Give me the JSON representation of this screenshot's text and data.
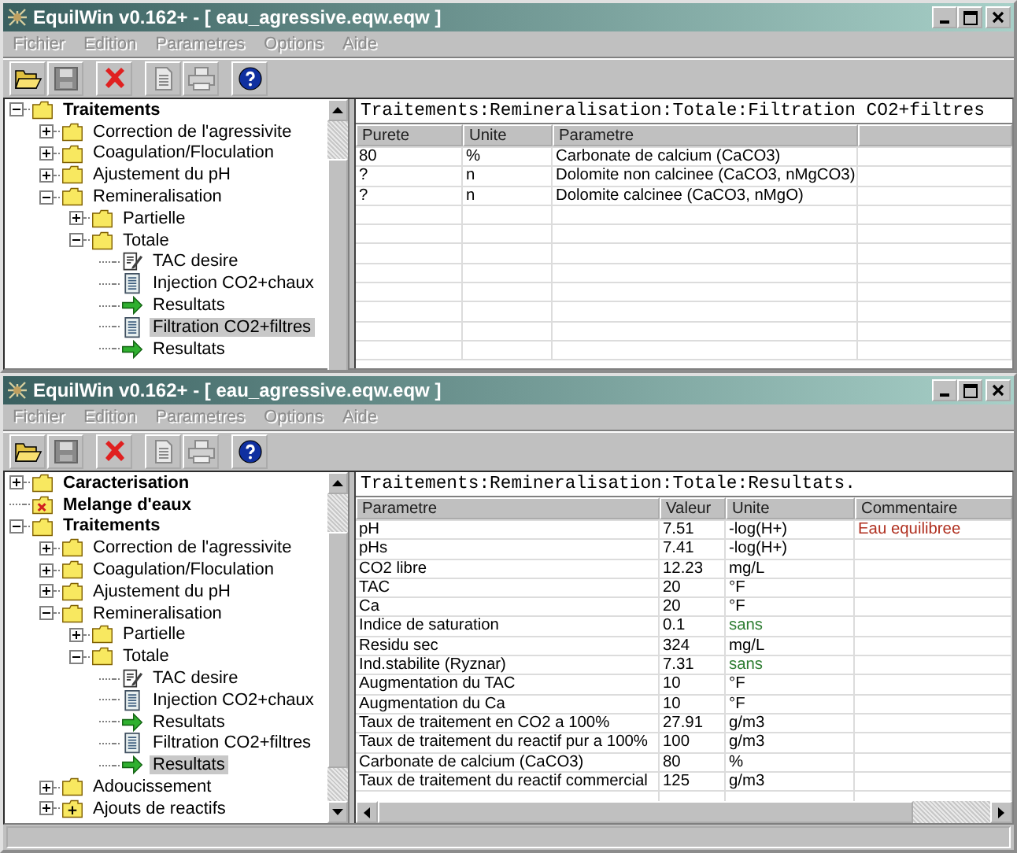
{
  "windows": [
    {
      "title": "EquilWin v0.162+ - [ eau_agressive.eqw.eqw ]",
      "menu": [
        {
          "label": "Fichier",
          "disabled": true
        },
        {
          "label": "Edition",
          "disabled": true
        },
        {
          "label": "Parametres",
          "disabled": true
        },
        {
          "label": "Options",
          "disabled": true
        },
        {
          "label": "Aide",
          "disabled": true
        }
      ],
      "toolbar_groups": [
        [
          {
            "kind": "open",
            "disabled": false
          },
          {
            "kind": "save",
            "disabled": true
          }
        ],
        [
          {
            "kind": "delete",
            "disabled": false
          }
        ],
        [
          {
            "kind": "copy",
            "disabled": true
          },
          {
            "kind": "print",
            "disabled": true
          }
        ],
        [
          {
            "kind": "help",
            "disabled": false
          }
        ]
      ],
      "tree": [
        {
          "label": "Traitements",
          "kind": "folder",
          "expanded": true,
          "selected": false,
          "children": [
            {
              "label": "Correction de l'agressivite",
              "kind": "folder",
              "expanded": false,
              "selected": false
            },
            {
              "label": "Coagulation/Floculation",
              "kind": "folder",
              "expanded": false,
              "selected": false
            },
            {
              "label": "Ajustement du pH",
              "kind": "folder",
              "expanded": false,
              "selected": false
            },
            {
              "label": "Remineralisation",
              "kind": "folder",
              "expanded": true,
              "selected": false,
              "children": [
                {
                  "label": "Partielle",
                  "kind": "folder",
                  "expanded": false,
                  "selected": false
                },
                {
                  "label": "Totale",
                  "kind": "folder",
                  "expanded": true,
                  "selected": false,
                  "children": [
                    {
                      "label": "TAC desire",
                      "kind": "form",
                      "selected": false
                    },
                    {
                      "label": "Injection CO2+chaux",
                      "kind": "doc",
                      "selected": false
                    },
                    {
                      "label": "Resultats",
                      "kind": "arrow",
                      "selected": false
                    },
                    {
                      "label": "Filtration CO2+filtres",
                      "kind": "doc",
                      "selected": true
                    },
                    {
                      "label": "Resultats",
                      "kind": "arrow",
                      "selected": false
                    }
                  ]
                }
              ]
            }
          ]
        }
      ],
      "heading": "Traitements:Remineralisation:Totale:Filtration CO2+filtres",
      "columns": [
        "Purete",
        "Unite",
        "Parametre",
        ""
      ],
      "rows": [
        [
          "80",
          "%",
          "Carbonate de calcium (CaCO3)"
        ],
        [
          "?",
          "n",
          "Dolomite non calcinee (CaCO3, nMgCO3)"
        ],
        [
          "?",
          "n",
          "Dolomite calcinee (CaCO3, nMgO)"
        ]
      ]
    },
    {
      "title": "EquilWin v0.162+ - [ eau_agressive.eqw.eqw ]",
      "menu": [
        {
          "label": "Fichier",
          "disabled": true
        },
        {
          "label": "Edition",
          "disabled": true
        },
        {
          "label": "Parametres",
          "disabled": true
        },
        {
          "label": "Options",
          "disabled": true
        },
        {
          "label": "Aide",
          "disabled": true
        }
      ],
      "toolbar_groups": [
        [
          {
            "kind": "open",
            "disabled": false
          },
          {
            "kind": "save",
            "disabled": true
          }
        ],
        [
          {
            "kind": "delete",
            "disabled": false
          }
        ],
        [
          {
            "kind": "copy",
            "disabled": true
          },
          {
            "kind": "print",
            "disabled": true
          }
        ],
        [
          {
            "kind": "help",
            "disabled": false
          }
        ]
      ],
      "tree": [
        {
          "label": "Caracterisation",
          "kind": "folder",
          "expanded": false,
          "selected": false
        },
        {
          "label": "Melange d'eaux",
          "kind": "folder-x",
          "selected": false
        },
        {
          "label": "Traitements",
          "kind": "folder",
          "expanded": true,
          "selected": false,
          "children": [
            {
              "label": "Correction de l'agressivite",
              "kind": "folder",
              "expanded": false,
              "selected": false
            },
            {
              "label": "Coagulation/Floculation",
              "kind": "folder",
              "expanded": false,
              "selected": false
            },
            {
              "label": "Ajustement du pH",
              "kind": "folder",
              "expanded": false,
              "selected": false
            },
            {
              "label": "Remineralisation",
              "kind": "folder",
              "expanded": true,
              "selected": false,
              "children": [
                {
                  "label": "Partielle",
                  "kind": "folder",
                  "expanded": false,
                  "selected": false
                },
                {
                  "label": "Totale",
                  "kind": "folder",
                  "expanded": true,
                  "selected": false,
                  "children": [
                    {
                      "label": "TAC desire",
                      "kind": "form",
                      "selected": false
                    },
                    {
                      "label": "Injection CO2+chaux",
                      "kind": "doc",
                      "selected": false
                    },
                    {
                      "label": "Resultats",
                      "kind": "arrow",
                      "selected": false
                    },
                    {
                      "label": "Filtration CO2+filtres",
                      "kind": "doc",
                      "selected": false
                    },
                    {
                      "label": "Resultats",
                      "kind": "arrow",
                      "selected": true
                    }
                  ]
                }
              ]
            },
            {
              "label": "Adoucissement",
              "kind": "folder",
              "expanded": false,
              "selected": false
            },
            {
              "label": "Ajouts de reactifs",
              "kind": "folder-plus",
              "expanded": false,
              "selected": false
            }
          ]
        }
      ],
      "heading": "Traitements:Remineralisation:Totale:Resultats.",
      "columns": [
        "Parametre",
        "Valeur",
        "Unite",
        "Commentaire"
      ],
      "rows": [
        [
          "pH",
          "7.51",
          "-log(H+)",
          {
            "text": "Eau equilibree",
            "color": "#b03020"
          }
        ],
        [
          "pHs",
          "7.41",
          "-log(H+)"
        ],
        [
          "CO2 libre",
          "12.23",
          "mg/L"
        ],
        [
          "TAC",
          "20",
          "°F"
        ],
        [
          "Ca",
          "20",
          "°F"
        ],
        [
          "Indice de saturation",
          "0.1",
          {
            "text": "sans",
            "color": "#2e7d32"
          }
        ],
        [
          "Residu sec",
          "324",
          "mg/L"
        ],
        [
          "Ind.stabilite (Ryznar)",
          "7.31",
          {
            "text": "sans",
            "color": "#2e7d32"
          }
        ],
        [
          "Augmentation du TAC",
          "10",
          "°F"
        ],
        [
          "Augmentation du Ca",
          "10",
          "°F"
        ],
        [
          "Taux de traitement en CO2 a 100%",
          "27.91",
          "g/m3"
        ],
        [
          "Taux de traitement du reactif pur a 100%",
          "100",
          "g/m3"
        ],
        [
          "Carbonate de calcium (CaCO3)",
          "80",
          "%"
        ],
        [
          "Taux de traitement du reactif commercial",
          "125",
          "g/m3"
        ]
      ]
    }
  ]
}
